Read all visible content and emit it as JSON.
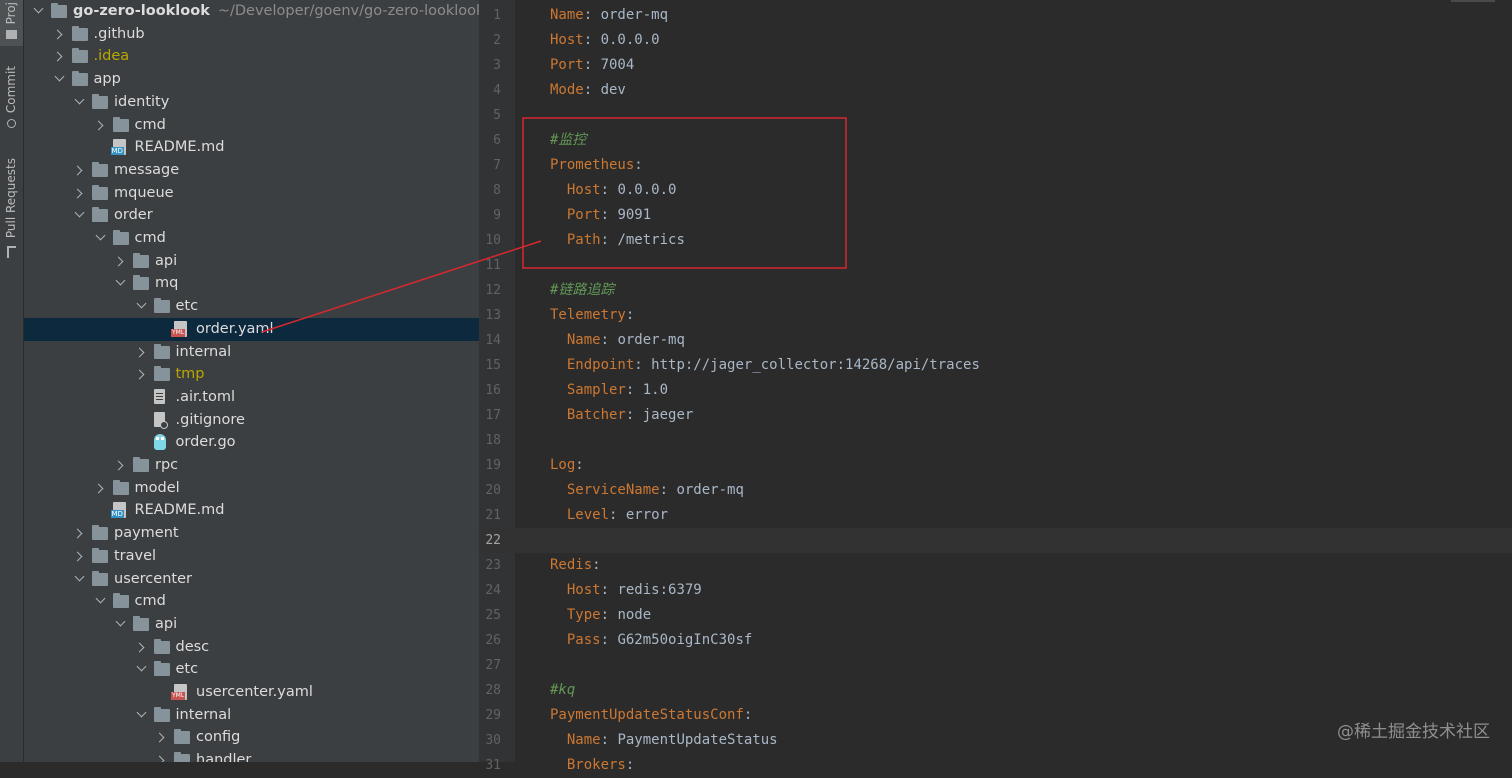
{
  "tool_stripe": {
    "buttons": [
      {
        "label": "Project",
        "visible_text": "Proj",
        "active": true
      },
      {
        "label": "Commit"
      },
      {
        "label": "Pull Requests"
      }
    ]
  },
  "project_tree": {
    "rows": [
      {
        "depth": 0,
        "type": "folder",
        "state": "expanded",
        "label": "go-zero-looklook",
        "hint": "~/Developer/goenv/go-zero-looklook",
        "bold": true
      },
      {
        "depth": 1,
        "type": "folder",
        "state": "collapsed",
        "label": ".github"
      },
      {
        "depth": 1,
        "type": "folder",
        "state": "collapsed",
        "label": ".idea",
        "color": "olive"
      },
      {
        "depth": 1,
        "type": "folder",
        "state": "expanded",
        "label": "app"
      },
      {
        "depth": 2,
        "type": "folder",
        "state": "expanded",
        "label": "identity"
      },
      {
        "depth": 3,
        "type": "folder",
        "state": "collapsed",
        "label": "cmd"
      },
      {
        "depth": 3,
        "type": "md",
        "state": "none",
        "label": "README.md"
      },
      {
        "depth": 2,
        "type": "folder",
        "state": "collapsed",
        "label": "message"
      },
      {
        "depth": 2,
        "type": "folder",
        "state": "collapsed",
        "label": "mqueue"
      },
      {
        "depth": 2,
        "type": "folder",
        "state": "expanded",
        "label": "order"
      },
      {
        "depth": 3,
        "type": "folder",
        "state": "expanded",
        "label": "cmd"
      },
      {
        "depth": 4,
        "type": "folder",
        "state": "collapsed",
        "label": "api"
      },
      {
        "depth": 4,
        "type": "folder",
        "state": "expanded",
        "label": "mq"
      },
      {
        "depth": 5,
        "type": "folder",
        "state": "expanded",
        "label": "etc"
      },
      {
        "depth": 6,
        "type": "yaml",
        "state": "none",
        "label": "order.yaml",
        "selected": true
      },
      {
        "depth": 5,
        "type": "folder",
        "state": "collapsed",
        "label": "internal"
      },
      {
        "depth": 5,
        "type": "folder",
        "state": "collapsed",
        "label": "tmp",
        "color": "olive"
      },
      {
        "depth": 5,
        "type": "text",
        "state": "none",
        "label": ".air.toml"
      },
      {
        "depth": 5,
        "type": "gitignore",
        "state": "none",
        "label": ".gitignore"
      },
      {
        "depth": 5,
        "type": "gofile",
        "state": "none",
        "label": "order.go"
      },
      {
        "depth": 4,
        "type": "folder",
        "state": "collapsed",
        "label": "rpc"
      },
      {
        "depth": 3,
        "type": "folder",
        "state": "collapsed",
        "label": "model"
      },
      {
        "depth": 3,
        "type": "md",
        "state": "none",
        "label": "README.md"
      },
      {
        "depth": 2,
        "type": "folder",
        "state": "collapsed",
        "label": "payment"
      },
      {
        "depth": 2,
        "type": "folder",
        "state": "collapsed",
        "label": "travel"
      },
      {
        "depth": 2,
        "type": "folder",
        "state": "expanded",
        "label": "usercenter"
      },
      {
        "depth": 3,
        "type": "folder",
        "state": "expanded",
        "label": "cmd"
      },
      {
        "depth": 4,
        "type": "folder",
        "state": "expanded",
        "label": "api"
      },
      {
        "depth": 5,
        "type": "folder",
        "state": "collapsed",
        "label": "desc"
      },
      {
        "depth": 5,
        "type": "folder",
        "state": "expanded",
        "label": "etc"
      },
      {
        "depth": 6,
        "type": "yaml",
        "state": "none",
        "label": "usercenter.yaml"
      },
      {
        "depth": 5,
        "type": "folder",
        "state": "expanded",
        "label": "internal"
      },
      {
        "depth": 6,
        "type": "folder",
        "state": "collapsed",
        "label": "config"
      },
      {
        "depth": 6,
        "type": "folder",
        "state": "collapsed",
        "label": "handler"
      }
    ]
  },
  "editor": {
    "current_line": 22,
    "lines": [
      {
        "n": "1",
        "parts": [
          [
            "k",
            "Name"
          ],
          [
            "p",
            ": "
          ],
          [
            "v",
            "order-mq"
          ]
        ]
      },
      {
        "n": "2",
        "parts": [
          [
            "k",
            "Host"
          ],
          [
            "p",
            ": "
          ],
          [
            "v",
            "0.0.0.0"
          ]
        ]
      },
      {
        "n": "3",
        "parts": [
          [
            "k",
            "Port"
          ],
          [
            "p",
            ": "
          ],
          [
            "v",
            "7004"
          ]
        ]
      },
      {
        "n": "4",
        "parts": [
          [
            "k",
            "Mode"
          ],
          [
            "p",
            ": "
          ],
          [
            "v",
            "dev"
          ]
        ]
      },
      {
        "n": "5",
        "parts": []
      },
      {
        "n": "6",
        "parts": [
          [
            "c",
            "#监控"
          ]
        ]
      },
      {
        "n": "7",
        "parts": [
          [
            "k",
            "Prometheus"
          ],
          [
            "p",
            ":"
          ]
        ]
      },
      {
        "n": "8",
        "parts": [
          [
            "p",
            "  "
          ],
          [
            "k",
            "Host"
          ],
          [
            "p",
            ": "
          ],
          [
            "v",
            "0.0.0.0"
          ]
        ]
      },
      {
        "n": "9",
        "parts": [
          [
            "p",
            "  "
          ],
          [
            "k",
            "Port"
          ],
          [
            "p",
            ": "
          ],
          [
            "v",
            "9091"
          ]
        ]
      },
      {
        "n": "10",
        "parts": [
          [
            "p",
            "  "
          ],
          [
            "k",
            "Path"
          ],
          [
            "p",
            ": "
          ],
          [
            "v",
            "/metrics"
          ]
        ]
      },
      {
        "n": "11",
        "parts": []
      },
      {
        "n": "12",
        "parts": [
          [
            "c",
            "#链路追踪"
          ]
        ]
      },
      {
        "n": "13",
        "parts": [
          [
            "k",
            "Telemetry"
          ],
          [
            "p",
            ":"
          ]
        ]
      },
      {
        "n": "14",
        "parts": [
          [
            "p",
            "  "
          ],
          [
            "k",
            "Name"
          ],
          [
            "p",
            ": "
          ],
          [
            "v",
            "order-mq"
          ]
        ]
      },
      {
        "n": "15",
        "parts": [
          [
            "p",
            "  "
          ],
          [
            "k",
            "Endpoint"
          ],
          [
            "p",
            ": "
          ],
          [
            "v",
            "http://jager_collector:14268/api/traces"
          ]
        ]
      },
      {
        "n": "16",
        "parts": [
          [
            "p",
            "  "
          ],
          [
            "k",
            "Sampler"
          ],
          [
            "p",
            ": "
          ],
          [
            "v",
            "1.0"
          ]
        ]
      },
      {
        "n": "17",
        "parts": [
          [
            "p",
            "  "
          ],
          [
            "k",
            "Batcher"
          ],
          [
            "p",
            ": "
          ],
          [
            "v",
            "jaeger"
          ]
        ]
      },
      {
        "n": "18",
        "parts": []
      },
      {
        "n": "19",
        "parts": [
          [
            "k",
            "Log"
          ],
          [
            "p",
            ":"
          ]
        ]
      },
      {
        "n": "20",
        "parts": [
          [
            "p",
            "  "
          ],
          [
            "k",
            "ServiceName"
          ],
          [
            "p",
            ": "
          ],
          [
            "v",
            "order-mq"
          ]
        ]
      },
      {
        "n": "21",
        "parts": [
          [
            "p",
            "  "
          ],
          [
            "k",
            "Level"
          ],
          [
            "p",
            ": "
          ],
          [
            "v",
            "error"
          ]
        ]
      },
      {
        "n": "22",
        "parts": []
      },
      {
        "n": "23",
        "parts": [
          [
            "k",
            "Redis"
          ],
          [
            "p",
            ":"
          ]
        ]
      },
      {
        "n": "24",
        "parts": [
          [
            "p",
            "  "
          ],
          [
            "k",
            "Host"
          ],
          [
            "p",
            ": "
          ],
          [
            "v",
            "redis:6379"
          ]
        ]
      },
      {
        "n": "25",
        "parts": [
          [
            "p",
            "  "
          ],
          [
            "k",
            "Type"
          ],
          [
            "p",
            ": "
          ],
          [
            "v",
            "node"
          ]
        ]
      },
      {
        "n": "26",
        "parts": [
          [
            "p",
            "  "
          ],
          [
            "k",
            "Pass"
          ],
          [
            "p",
            ": "
          ],
          [
            "v",
            "G62m50oigInC30sf"
          ]
        ]
      },
      {
        "n": "27",
        "parts": []
      },
      {
        "n": "28",
        "parts": [
          [
            "c",
            "#kq"
          ]
        ]
      },
      {
        "n": "29",
        "parts": [
          [
            "k",
            "PaymentUpdateStatusConf"
          ],
          [
            "p",
            ":"
          ]
        ]
      },
      {
        "n": "30",
        "parts": [
          [
            "p",
            "  "
          ],
          [
            "k",
            "Name"
          ],
          [
            "p",
            ": "
          ],
          [
            "v",
            "PaymentUpdateStatus"
          ]
        ]
      },
      {
        "n": "31",
        "parts": [
          [
            "p",
            "  "
          ],
          [
            "k",
            "Brokers"
          ],
          [
            "p",
            ":"
          ]
        ]
      }
    ]
  },
  "annotation": {
    "color": "#d7282f",
    "highlight_lines": [
      "6",
      "10"
    ],
    "arrow_from_file": "order.yaml"
  },
  "watermark": "@稀土掘金技术社区"
}
